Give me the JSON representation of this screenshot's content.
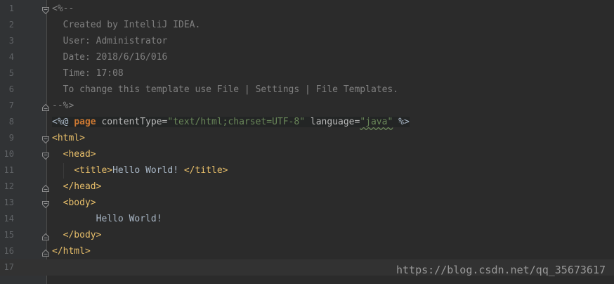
{
  "editor": {
    "lines": [
      {
        "num": "1",
        "segments": [
          {
            "t": "<%--",
            "c": "c-comment"
          }
        ]
      },
      {
        "num": "2",
        "segments": [
          {
            "t": "  Created by IntelliJ IDEA.",
            "c": "c-comment"
          }
        ]
      },
      {
        "num": "3",
        "segments": [
          {
            "t": "  User: Administrator",
            "c": "c-comment"
          }
        ]
      },
      {
        "num": "4",
        "segments": [
          {
            "t": "  Date: 2018/6/16/016",
            "c": "c-comment"
          }
        ]
      },
      {
        "num": "5",
        "segments": [
          {
            "t": "  Time: 17:08",
            "c": "c-comment"
          }
        ]
      },
      {
        "num": "6",
        "segments": [
          {
            "t": "  To change this template use File | Settings | File Templates.",
            "c": "c-comment"
          }
        ]
      },
      {
        "num": "7",
        "segments": [
          {
            "t": "--%>",
            "c": "c-comment"
          }
        ]
      },
      {
        "num": "8",
        "segments": [
          {
            "t": "<%@ ",
            "c": "c-dir-bracket directive-bg"
          },
          {
            "t": "page",
            "c": "c-keyword directive-bg"
          },
          {
            "t": " contentType=",
            "c": "c-attr directive-bg"
          },
          {
            "t": "\"text/html;charset=UTF-8\"",
            "c": "c-string directive-bg"
          },
          {
            "t": " language=",
            "c": "c-attr directive-bg"
          },
          {
            "t": "\"java\"",
            "c": "c-string directive-bg wavy"
          },
          {
            "t": " %>",
            "c": "c-dir-bracket directive-bg"
          }
        ]
      },
      {
        "num": "9",
        "segments": [
          {
            "t": "<html>",
            "c": "c-tag"
          }
        ]
      },
      {
        "num": "10",
        "segments": [
          {
            "t": "  ",
            "c": "c-text"
          },
          {
            "t": "<head>",
            "c": "c-tag"
          }
        ]
      },
      {
        "num": "11",
        "segments": [
          {
            "t": "    ",
            "c": "c-text"
          },
          {
            "t": "<title>",
            "c": "c-tag"
          },
          {
            "t": "Hello World! ",
            "c": "c-text"
          },
          {
            "t": "</title>",
            "c": "c-tag"
          }
        ]
      },
      {
        "num": "12",
        "segments": [
          {
            "t": "  ",
            "c": "c-text"
          },
          {
            "t": "</head>",
            "c": "c-tag"
          }
        ]
      },
      {
        "num": "13",
        "segments": [
          {
            "t": "  ",
            "c": "c-text"
          },
          {
            "t": "<body>",
            "c": "c-tag"
          }
        ]
      },
      {
        "num": "14",
        "segments": [
          {
            "t": "        Hello World!",
            "c": "c-text"
          }
        ]
      },
      {
        "num": "15",
        "segments": [
          {
            "t": "  ",
            "c": "c-text"
          },
          {
            "t": "</body>",
            "c": "c-tag"
          }
        ]
      },
      {
        "num": "16",
        "segments": [
          {
            "t": "</html>",
            "c": "c-tag"
          }
        ]
      },
      {
        "num": "17",
        "segments": []
      }
    ],
    "fold_markers": {
      "1": "open",
      "7": "close",
      "9": "open",
      "10": "open",
      "12": "close",
      "13": "open",
      "15": "close",
      "16": "close"
    },
    "current_line": "17"
  },
  "watermark": "https://blog.csdn.net/qq_35673617",
  "colors": {
    "background": "#2b2b2b",
    "gutter": "#313335",
    "comment": "#808080",
    "tag": "#e8bf6a",
    "keyword": "#cc7832",
    "string": "#6a8759"
  }
}
